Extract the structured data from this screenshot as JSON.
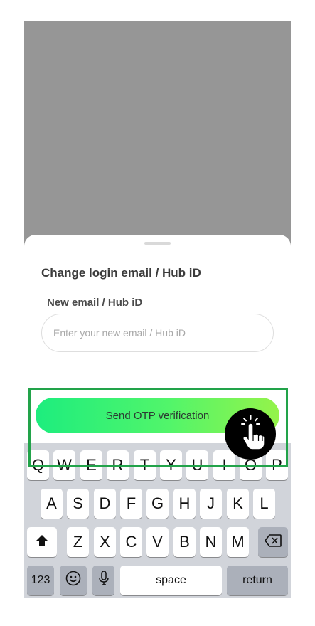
{
  "sheet": {
    "title": "Change login email / Hub iD",
    "field_label": "New email / Hub iD",
    "email_placeholder": "Enter your new email / Hub iD",
    "email_value": "",
    "send_button_label": "Send OTP verification"
  },
  "keyboard": {
    "row1": [
      "Q",
      "W",
      "E",
      "R",
      "T",
      "Y",
      "U",
      "I",
      "O",
      "P"
    ],
    "row2": [
      "A",
      "S",
      "D",
      "F",
      "G",
      "H",
      "J",
      "K",
      "L"
    ],
    "row3": [
      "Z",
      "X",
      "C",
      "V",
      "B",
      "N",
      "M"
    ],
    "numbers_label": "123",
    "space_label": "space",
    "return_label": "return",
    "icons": [
      "shift-icon",
      "backspace-icon",
      "emoji-icon",
      "microphone-icon"
    ]
  },
  "overlay": {
    "tap_indicator_icon": "hand-pointer-icon",
    "highlight_color": "#22a34a"
  },
  "colors": {
    "button_gradient_start": "#1ded7e",
    "button_gradient_end": "#95f34a",
    "backdrop": "#969696",
    "keyboard_bg": "#d1d4da"
  }
}
